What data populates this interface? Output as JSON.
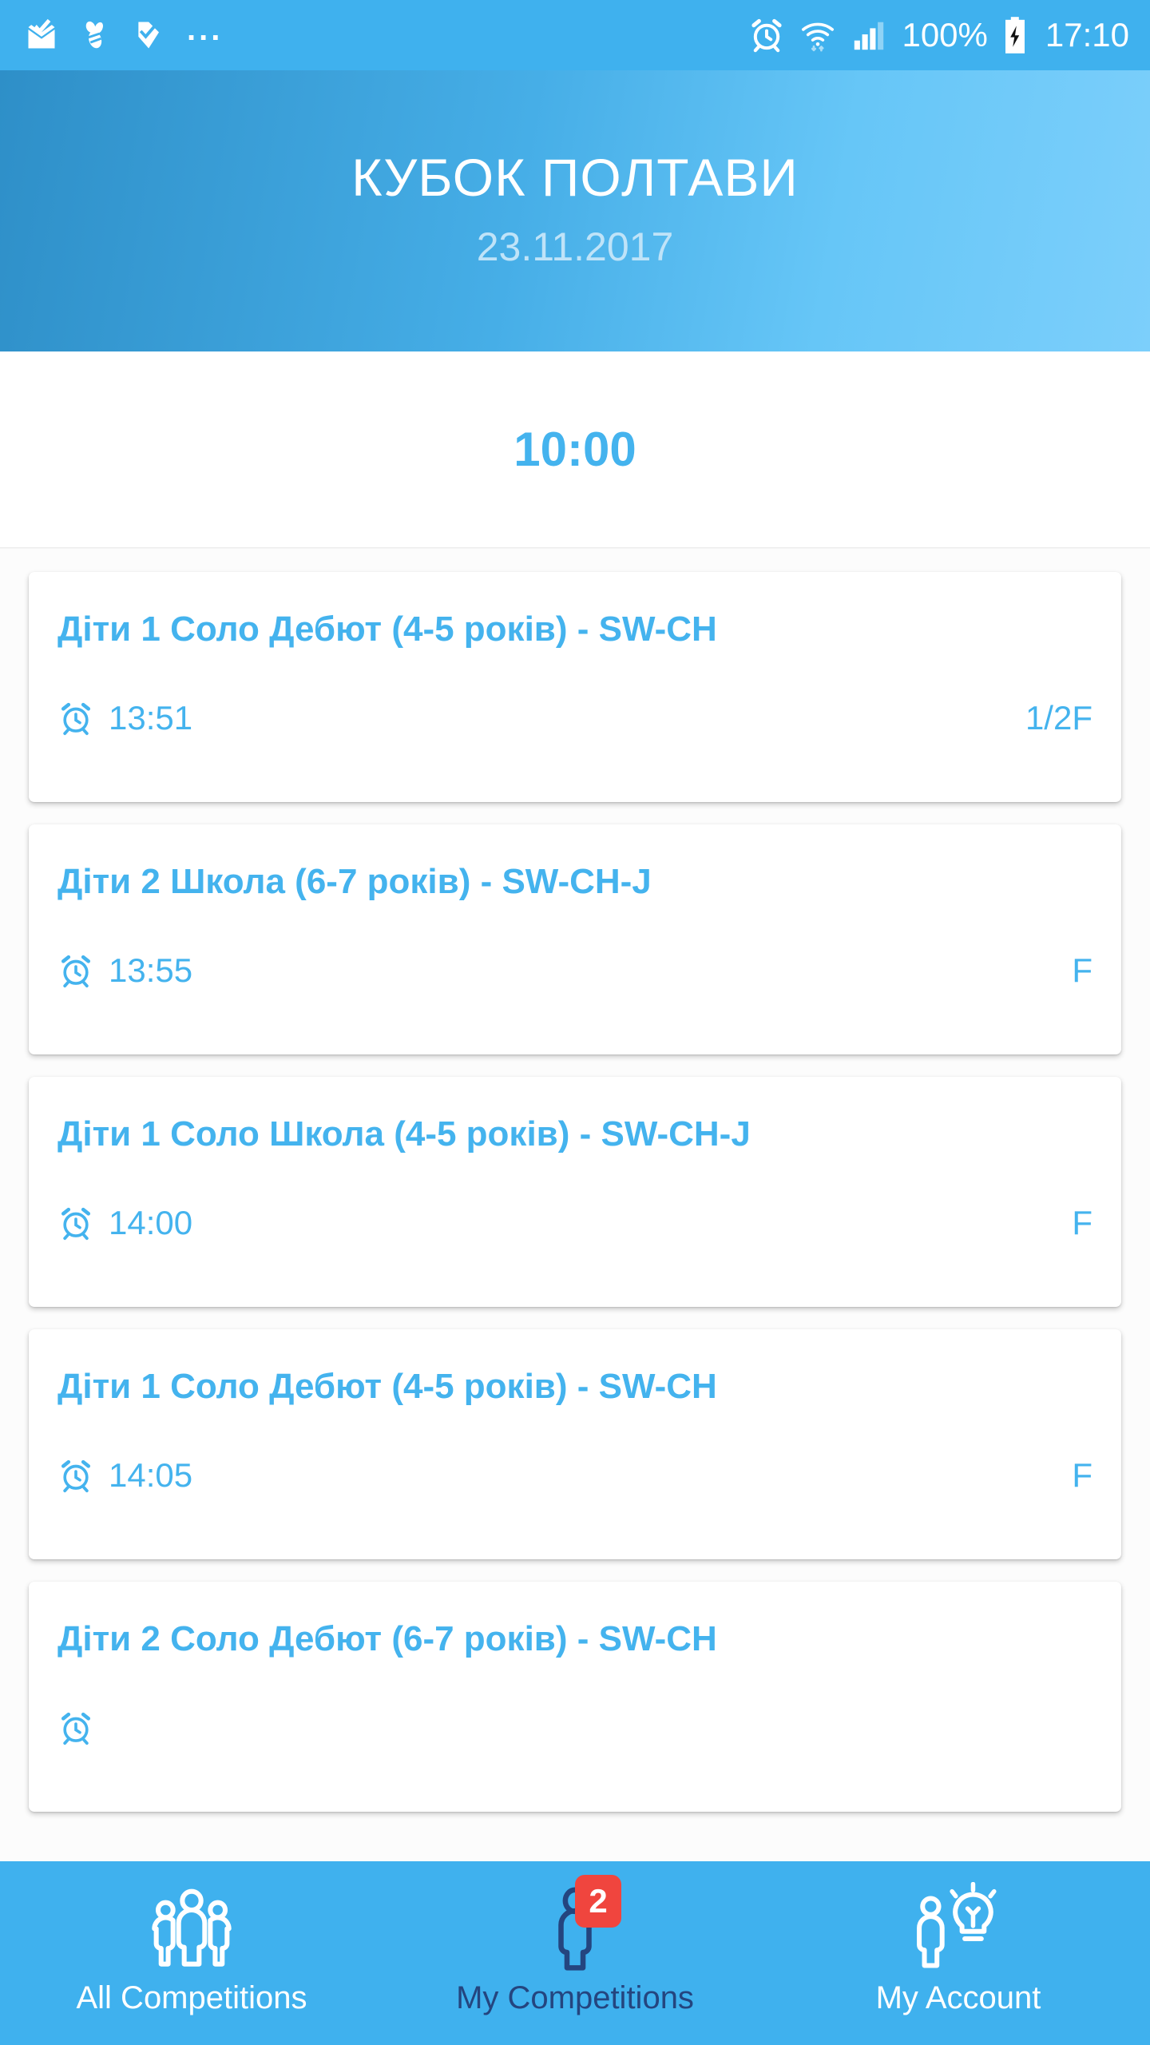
{
  "status_bar": {
    "icons_left": [
      "mail-check-icon",
      "bee-icon",
      "checkmark-badge-icon",
      "more-dots-icon"
    ],
    "dots": "...",
    "icons_right": [
      "alarm-clock-icon",
      "wifi-icon",
      "signal-bars-icon",
      "battery-charging-icon"
    ],
    "battery_percent": "100%",
    "time": "17:10"
  },
  "header": {
    "title": "КУБОК ПОЛТАВИ",
    "date": "23.11.2017"
  },
  "time_band": {
    "time": "10:00"
  },
  "list": {
    "cards": [
      {
        "title": "Діти 1 Соло Дебют (4-5 років) - SW-CH",
        "time": "13:51",
        "badge": "1/2F",
        "clock_icon": "alarm-clock-icon"
      },
      {
        "title": "Діти 2 Школа (6-7 років) - SW-CH-J",
        "time": "13:55",
        "badge": "F",
        "clock_icon": "alarm-clock-icon"
      },
      {
        "title": "Діти 1 Соло Школа (4-5 років) - SW-CH-J",
        "time": "14:00",
        "badge": "F",
        "clock_icon": "alarm-clock-icon"
      },
      {
        "title": "Діти 1 Соло Дебют (4-5 років) - SW-CH",
        "time": "14:05",
        "badge": "F",
        "clock_icon": "alarm-clock-icon"
      },
      {
        "title": "Діти 2 Соло Дебют (6-7 років) - SW-CH",
        "time": "",
        "badge": "",
        "clock_icon": "alarm-clock-icon"
      }
    ]
  },
  "bottom_nav": {
    "items": [
      {
        "label": "All Competitions",
        "icon": "people-group-icon",
        "active": false,
        "badge": ""
      },
      {
        "label": "My Competitions",
        "icon": "person-icon",
        "active": true,
        "badge": "2"
      },
      {
        "label": "My Account",
        "icon": "person-lightbulb-icon",
        "active": false,
        "badge": ""
      }
    ]
  },
  "colors": {
    "accent": "#44B3EE",
    "status_bar": "#3FB1EE",
    "header_gradient_start": "#2E8FC8",
    "header_gradient_end": "#7CCFFB",
    "nav_active": "#24457F",
    "badge_red": "#F0453E",
    "subtitle": "#BFE3F8"
  }
}
